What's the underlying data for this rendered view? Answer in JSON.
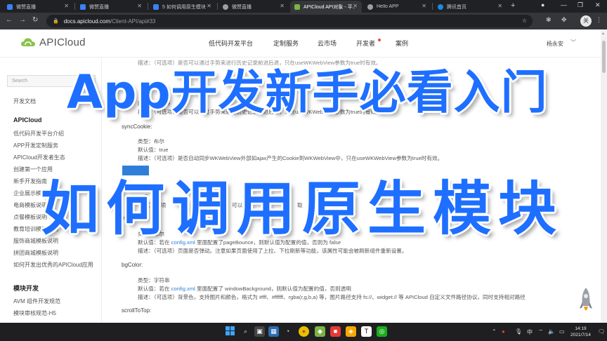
{
  "browser": {
    "tabs": [
      {
        "title": "微赞直播",
        "color": "#3b82f6"
      },
      {
        "title": "微赞直播",
        "color": "#3b82f6"
      },
      {
        "title": "5 如何调用原生模块",
        "color": "#3b82f6"
      },
      {
        "title": "微赞直播",
        "color": "#9e9e9e"
      },
      {
        "title": "APICloud API对象 - 平...",
        "color": "#7cb342",
        "active": true
      },
      {
        "title": "Hello APP",
        "color": "#9e9e9e"
      },
      {
        "title": "腾讯首页",
        "color": "#1e88e5"
      }
    ],
    "new_tab": "+",
    "url_host": "docs.apicloud.com",
    "url_path": "/Client-API/api#33",
    "profile_initial": "关"
  },
  "site": {
    "logo_text": "APICloud",
    "nav": [
      "低代码开发平台",
      "定制服务",
      "云市场",
      "开发者",
      "案例"
    ],
    "user": "杨永安",
    "accent_color": "#2f7fd8"
  },
  "sidebar": {
    "search_placeholder": "Search",
    "docs_link": "开发文档",
    "section1": "APICloud",
    "items1": [
      "低代码开发平台介绍",
      "APP开发定制服务",
      "APICloud开发者生态",
      "创建第一个应用",
      "新手开发指南",
      "企业展示模板说明",
      "电商模板说明",
      "点餐模板说明",
      "教育培训模板说明",
      "服饰商城模板说明",
      "拼团商城模板说明",
      "如何开发出优秀的APICloud应用"
    ],
    "section2": "模块开发",
    "items2": [
      "AVM 组件开发规范",
      "模块审核规范-H5"
    ]
  },
  "content": {
    "top_partial_1": "描述：（可选项）是否可以通过手势来进行历史记录前进后退，只在useWKWebView参数为true时有效。",
    "top_partial_2": "默认值：false",
    "top_partial_3": "描述：（可选项）是否可以通过手势来进行历史记录前进后退，只在useWKWebView参数为true时有效。",
    "syncCookie": {
      "name": "syncCookie:",
      "type": "类型：布尔",
      "default": "默认值：true",
      "desc": "描述：（可选项）是否自动同步WKWebView外部如ajax产生的Cookie到WKWebView中，只在useWKWebView参数为true时有效。"
    },
    "hidden": {
      "frag_type": "N 对",
      "frag_default": "E",
      "frag_desc_a": "（可选项",
      "frag_desc_b": "可以",
      "frag_desc_c": "取"
    },
    "bounce": {
      "name": "bounce:",
      "type": "类型：布尔",
      "default_pre": "默认值：若在 ",
      "default_link": "config.xml",
      "default_post": " 里面配置了pageBounce，则默认值为配置的值，否则为 false",
      "desc": "描述：（可选项）页面是否弹动。注意如果页面使用了上拉、下拉刷新等功能，该属性可能会被刷新组件重新设置。"
    },
    "bgColor": {
      "name": "bgColor:",
      "type": "类型：字符串",
      "default_pre": "默认值：若在 ",
      "default_link": "config.xml",
      "default_post": " 里面配置了 windowBackground，则默认值为配置的值，否则透明",
      "desc": "描述：（可选项）背景色，支持图片和颜色，格式为 #fff、#ffffff、rgba(r,g,b,a) 等，图片路径支持 fs://、widget:// 等 APICloud 自定义文件路径协议，同时支持相对路径"
    },
    "scrollToTop": {
      "name": "scrollToTop:"
    }
  },
  "overlay": {
    "title_top": "App开发新手必看入门",
    "title_mid": "如何调用原生模块",
    "color": "#1e6fff"
  },
  "taskbar": {
    "time": "14:19",
    "date": "2021/7/14",
    "lang": "中"
  }
}
